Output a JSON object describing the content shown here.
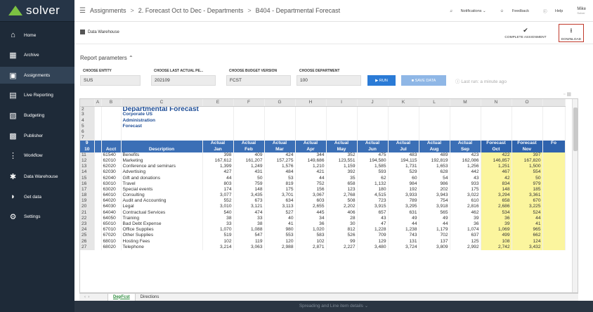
{
  "app": {
    "logo": "solver"
  },
  "sidebar": {
    "items": [
      {
        "label": "Home",
        "icon": "home-icon"
      },
      {
        "label": "Archive",
        "icon": "archive-icon"
      },
      {
        "label": "Assignments",
        "icon": "assignments-icon",
        "active": true
      },
      {
        "label": "Live Reporting",
        "icon": "live-reporting-icon"
      },
      {
        "label": "Budgeting",
        "icon": "budgeting-icon"
      },
      {
        "label": "Publisher",
        "icon": "publisher-icon"
      },
      {
        "label": "Workflow",
        "icon": "workflow-icon"
      },
      {
        "label": "Data Warehouse",
        "icon": "data-warehouse-icon"
      },
      {
        "label": "Get data",
        "icon": "get-data-icon"
      },
      {
        "label": "Settings",
        "icon": "settings-icon"
      }
    ]
  },
  "breadcrumb": [
    "Assignments",
    "2. Forecast Oct to Dec - Departments",
    "B404 - Departmental Forecast"
  ],
  "topbar": {
    "notifications": "Notifications",
    "feedback": "Feedback",
    "help": "Help",
    "user": "Mike",
    "user_sub": "Solver"
  },
  "subbar": {
    "title": "Data Warehouse",
    "complete": "Complete Assignment",
    "download": "Download"
  },
  "params": {
    "title": "Report parameters",
    "entity_label": "CHOOSE ENTITY",
    "entity_value": "SUS",
    "actual_label": "CHOOSE LAST ACTUAL PE...",
    "actual_value": "202109",
    "budget_label": "CHOOSE BUDGET VERSION",
    "budget_value": "FCST",
    "dept_label": "CHOOSE DEPARTMENT",
    "dept_value": "100",
    "run": "RUN",
    "save": "SAVE DATA",
    "last_run": "Last run: a minute ago"
  },
  "sheet": {
    "col_headers": [
      "A",
      "B",
      "C",
      "E",
      "F",
      "G",
      "H",
      "I",
      "J",
      "K",
      "L",
      "M",
      "N",
      "O"
    ],
    "title_rows": [
      {
        "rn": "2",
        "text": "Departmental Forecast",
        "big": true
      },
      {
        "rn": "3",
        "text": "Corporate US"
      },
      {
        "rn": "4",
        "text": "Administration"
      },
      {
        "rn": "5",
        "text": "Forecast"
      },
      {
        "rn": "6",
        "text": ""
      },
      {
        "rn": "7",
        "text": ""
      }
    ],
    "header_top": [
      "Actual",
      "Actual",
      "Actual",
      "Actual",
      "Actual",
      "Actual",
      "Actual",
      "Actual",
      "Actual",
      "Forecast",
      "Forecast",
      "Fo"
    ],
    "header_bottom": {
      "rn9": "9",
      "rn10": "10",
      "acct": "Acct",
      "desc": "Description",
      "months": [
        "Jan",
        "Feb",
        "Mar",
        "Apr",
        "May",
        "Jun",
        "Jul",
        "Aug",
        "Sep",
        "Oct",
        "Nov",
        ""
      ]
    },
    "rows": [
      {
        "rn": "11",
        "acct": "61540",
        "desc": "Benefits",
        "v": [
          "398",
          "409",
          "424",
          "344",
          "352",
          "475",
          "483",
          "489",
          "423",
          "422",
          "397"
        ]
      },
      {
        "rn": "12",
        "acct": "62010",
        "desc": "Marketing",
        "v": [
          "167,612",
          "161,207",
          "157,275",
          "149,686",
          "123,551",
          "194,580",
          "194,115",
          "192,819",
          "162,086",
          "146,857",
          "167,820"
        ]
      },
      {
        "rn": "13",
        "acct": "62020",
        "desc": "Conference and seminars",
        "v": [
          "1,399",
          "1,249",
          "1,576",
          "1,210",
          "1,159",
          "1,585",
          "1,731",
          "1,653",
          "1,256",
          "1,251",
          "1,500"
        ]
      },
      {
        "rn": "14",
        "acct": "62030",
        "desc": "Advertising",
        "v": [
          "427",
          "431",
          "484",
          "421",
          "392",
          "593",
          "529",
          "628",
          "442",
          "467",
          "554"
        ]
      },
      {
        "rn": "15",
        "acct": "62040",
        "desc": "Gift and donations",
        "v": [
          "44",
          "50",
          "53",
          "44",
          "35",
          "62",
          "60",
          "54",
          "43",
          "42",
          "50"
        ]
      },
      {
        "rn": "16",
        "acct": "63010",
        "desc": "Travel",
        "v": [
          "803",
          "759",
          "819",
          "752",
          "658",
          "1,132",
          "984",
          "986",
          "933",
          "834",
          "979"
        ]
      },
      {
        "rn": "17",
        "acct": "63020",
        "desc": "Special events",
        "v": [
          "174",
          "148",
          "175",
          "156",
          "123",
          "180",
          "192",
          "202",
          "175",
          "148",
          "185"
        ]
      },
      {
        "rn": "18",
        "acct": "64010",
        "desc": "Consulting",
        "v": [
          "3,077",
          "3,435",
          "3,701",
          "3,067",
          "2,768",
          "4,515",
          "3,933",
          "3,943",
          "3,022",
          "3,294",
          "3,361"
        ]
      },
      {
        "rn": "19",
        "acct": "64020",
        "desc": "Audit and Accounting",
        "v": [
          "552",
          "673",
          "634",
          "603",
          "508",
          "723",
          "789",
          "754",
          "610",
          "658",
          "670"
        ]
      },
      {
        "rn": "20",
        "acct": "64030",
        "desc": "Legal",
        "v": [
          "3,010",
          "3,121",
          "3,113",
          "2,655",
          "2,202",
          "3,915",
          "3,295",
          "3,918",
          "2,816",
          "2,686",
          "3,225"
        ]
      },
      {
        "rn": "21",
        "acct": "64040",
        "desc": "Contractual Services",
        "v": [
          "540",
          "474",
          "527",
          "445",
          "406",
          "657",
          "631",
          "565",
          "462",
          "534",
          "524"
        ]
      },
      {
        "rn": "22",
        "acct": "64050",
        "desc": "Training",
        "v": [
          "38",
          "33",
          "40",
          "34",
          "28",
          "43",
          "49",
          "49",
          "39",
          "36",
          "44"
        ]
      },
      {
        "rn": "23",
        "acct": "65010",
        "desc": "Bad Debt Expense",
        "v": [
          "33",
          "38",
          "41",
          "36",
          "30",
          "47",
          "44",
          "44",
          "36",
          "39",
          "41"
        ]
      },
      {
        "rn": "24",
        "acct": "67010",
        "desc": "Office Supplies",
        "v": [
          "1,070",
          "1,088",
          "980",
          "1,020",
          "812",
          "1,228",
          "1,238",
          "1,179",
          "1,074",
          "1,069",
          "965"
        ]
      },
      {
        "rn": "25",
        "acct": "67020",
        "desc": "Other Supplies",
        "v": [
          "519",
          "547",
          "553",
          "583",
          "526",
          "709",
          "743",
          "702",
          "637",
          "499",
          "662"
        ]
      },
      {
        "rn": "26",
        "acct": "68010",
        "desc": "Hosting Fees",
        "v": [
          "102",
          "119",
          "120",
          "102",
          "99",
          "129",
          "131",
          "137",
          "125",
          "108",
          "124"
        ]
      },
      {
        "rn": "27",
        "acct": "68020",
        "desc": "Telephone",
        "v": [
          "3,214",
          "3,063",
          "2,988",
          "2,871",
          "2,227",
          "3,480",
          "3,724",
          "3,809",
          "2,992",
          "2,742",
          "3,432"
        ]
      }
    ],
    "tabs": [
      "DepFcst",
      "Directions"
    ]
  },
  "footer": "Spreading and Line item details"
}
